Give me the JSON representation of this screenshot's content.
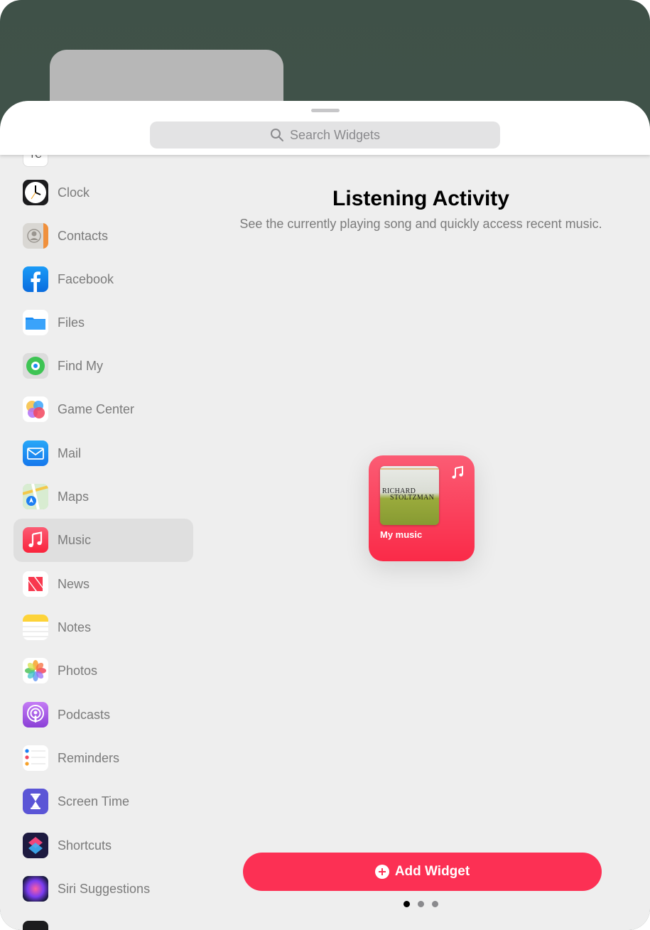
{
  "search": {
    "placeholder": "Search Widgets"
  },
  "sidebar": {
    "partial_top_label": "TC",
    "items": [
      {
        "label": "Clock",
        "icon": "clock-icon"
      },
      {
        "label": "Contacts",
        "icon": "contacts-icon"
      },
      {
        "label": "Facebook",
        "icon": "facebook-icon"
      },
      {
        "label": "Files",
        "icon": "files-icon"
      },
      {
        "label": "Find My",
        "icon": "find-my-icon"
      },
      {
        "label": "Game Center",
        "icon": "game-center-icon"
      },
      {
        "label": "Mail",
        "icon": "mail-icon"
      },
      {
        "label": "Maps",
        "icon": "maps-icon"
      },
      {
        "label": "Music",
        "icon": "music-icon",
        "selected": true
      },
      {
        "label": "News",
        "icon": "news-icon"
      },
      {
        "label": "Notes",
        "icon": "notes-icon"
      },
      {
        "label": "Photos",
        "icon": "photos-icon"
      },
      {
        "label": "Podcasts",
        "icon": "podcasts-icon"
      },
      {
        "label": "Reminders",
        "icon": "reminders-icon"
      },
      {
        "label": "Screen Time",
        "icon": "screen-time-icon"
      },
      {
        "label": "Shortcuts",
        "icon": "shortcuts-icon"
      },
      {
        "label": "Siri Suggestions",
        "icon": "siri-suggestions-icon"
      }
    ]
  },
  "detail": {
    "title": "Listening Activity",
    "subtitle": "See the currently playing song and quickly access recent music.",
    "widget": {
      "caption": "My music",
      "album_line1": "RICHARD",
      "album_line2": "STOLTZMAN"
    },
    "page_count": 3,
    "current_page": 1,
    "add_button_label": "Add Widget"
  },
  "colors": {
    "accent": "#fc3054",
    "selected_row": "#dfdfdf",
    "sheet_bg": "#eeeeee"
  }
}
